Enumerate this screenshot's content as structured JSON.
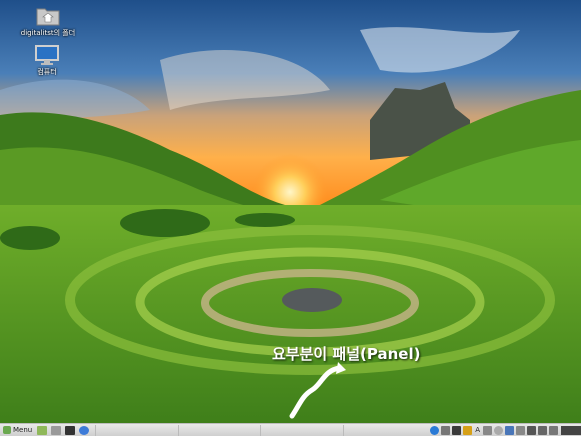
{
  "desktop": {
    "icons": [
      {
        "name": "home-folder",
        "label": "digitalitst의 폴더"
      },
      {
        "name": "computer",
        "label": "컴퓨터"
      }
    ]
  },
  "annotation": {
    "text": "요부분이 패널(Panel)"
  },
  "panel": {
    "menu_label": "Menu",
    "tray_letter": "A",
    "colors": {
      "panel_bg": "#dcdcdc",
      "accent": "#6aa84f"
    }
  }
}
